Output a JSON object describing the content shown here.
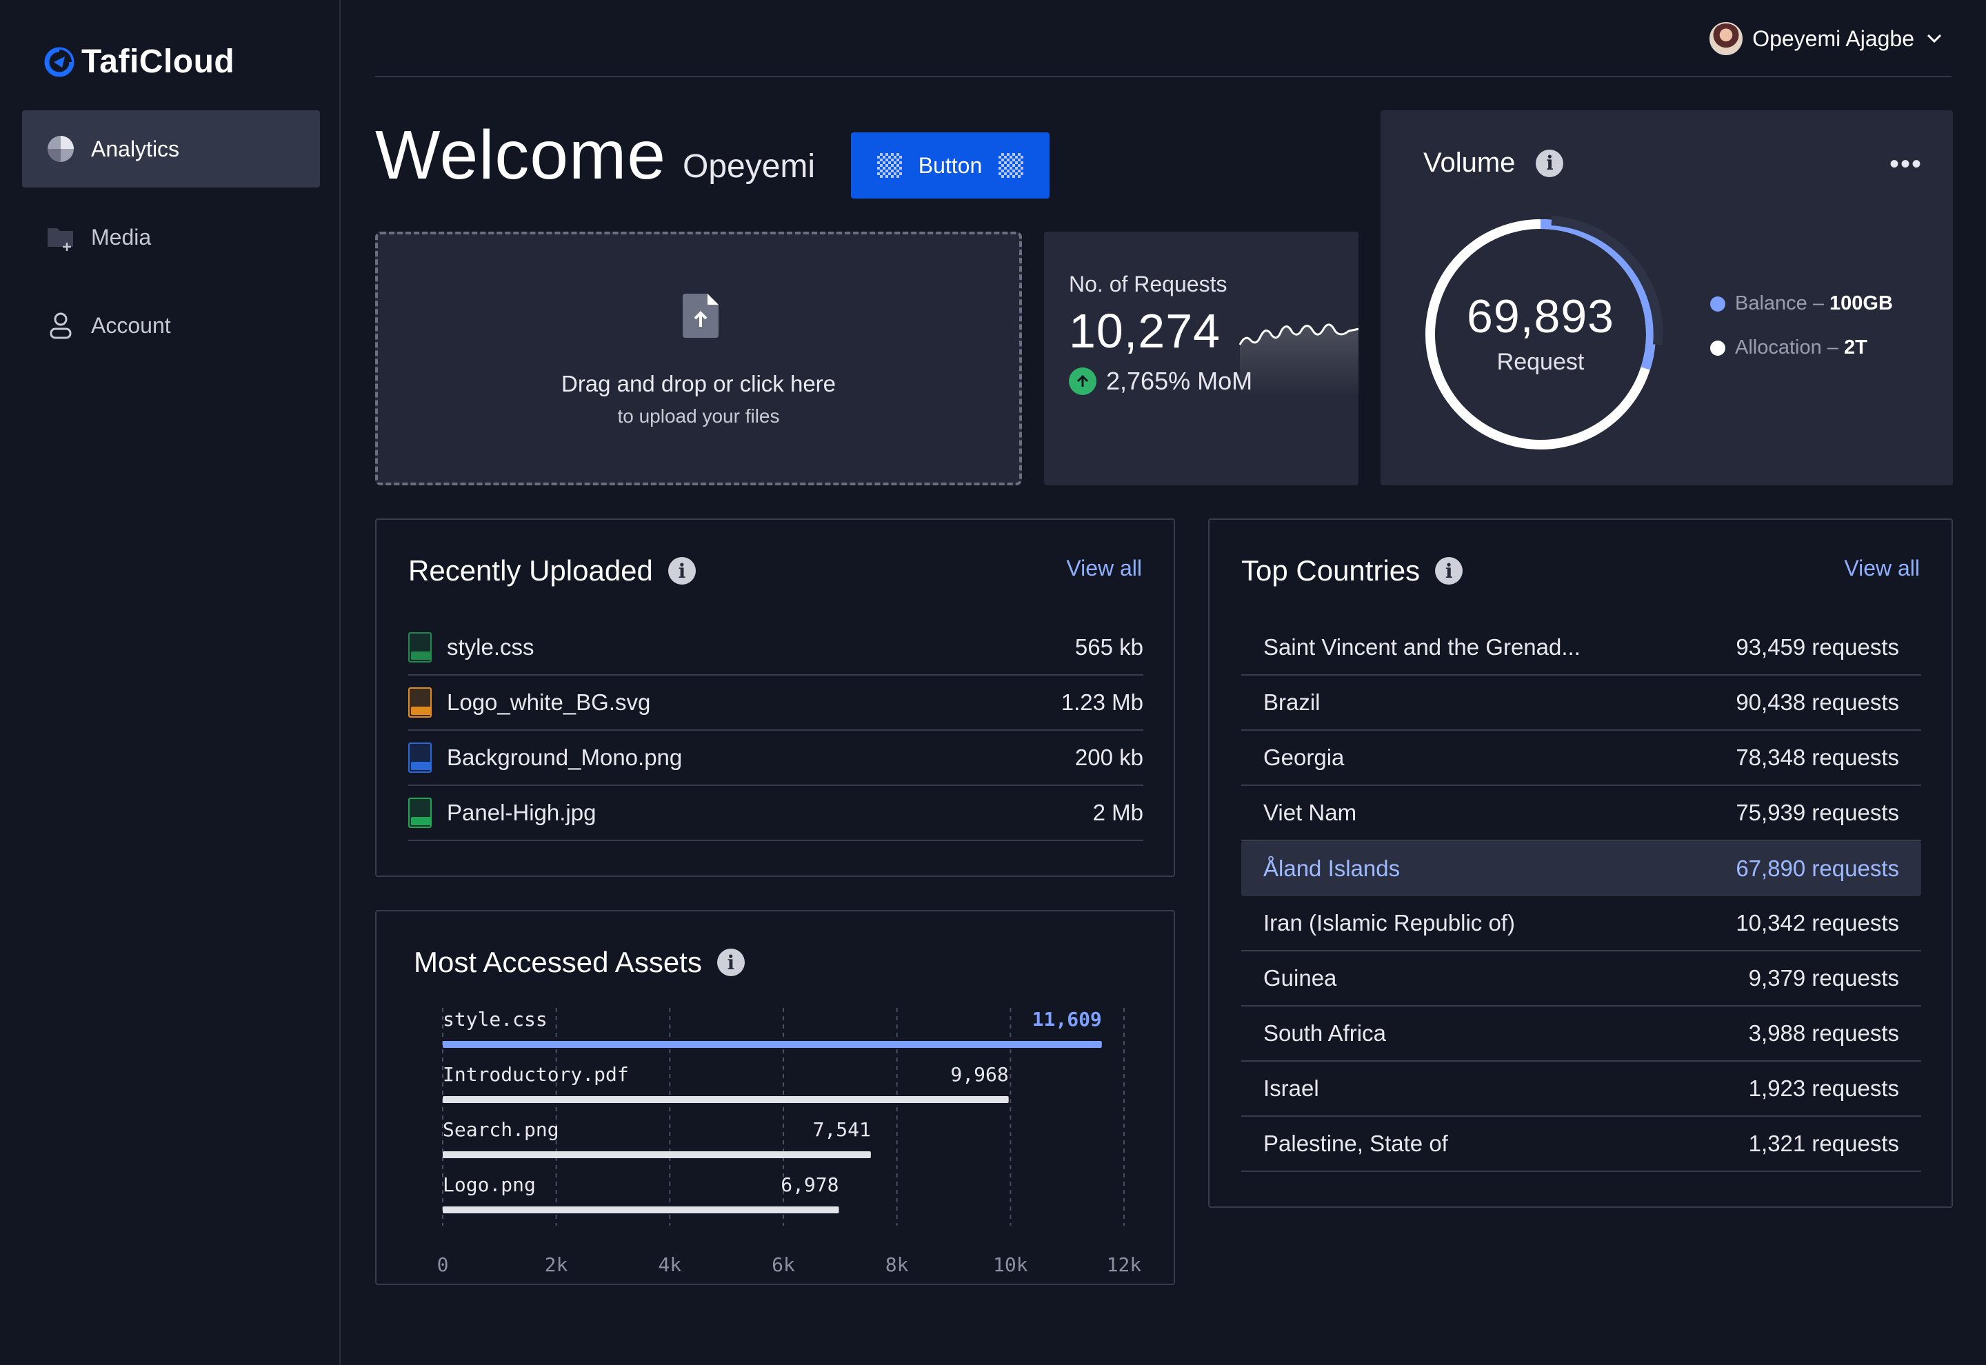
{
  "brand": {
    "name": "TafiCloud"
  },
  "sidebar": {
    "items": [
      {
        "label": "Analytics",
        "icon": "pie-chart-icon",
        "active": true
      },
      {
        "label": "Media",
        "icon": "folder-add-icon",
        "active": false
      },
      {
        "label": "Account",
        "icon": "user-icon",
        "active": false
      }
    ]
  },
  "header": {
    "user_name": "Opeyemi Ajagbe"
  },
  "welcome": {
    "title": "Welcome",
    "name": "Opeyemi",
    "button_label": "Button"
  },
  "upload": {
    "line1": "Drag and drop or click here",
    "line2": "to upload your files"
  },
  "requests": {
    "label": "No. of Requests",
    "value": "10,274",
    "change": "2,765% MoM"
  },
  "volume": {
    "title": "Volume",
    "value": "69,893",
    "unit": "Request",
    "legend": [
      {
        "label": "Balance – ",
        "value": "100GB",
        "color": "#7ea1ff"
      },
      {
        "label": "Allocation – ",
        "value": "2T",
        "color": "#ffffff"
      }
    ],
    "balance_fraction": 0.3
  },
  "recent": {
    "title": "Recently Uploaded",
    "view_all": "View all",
    "files": [
      {
        "name": "style.css",
        "size": "565 kb",
        "type": "css",
        "color": "#1f8a4c"
      },
      {
        "name": "Logo_white_BG.svg",
        "size": "1.23 Mb",
        "type": "svg",
        "color": "#e08a1e"
      },
      {
        "name": "Background_Mono.png",
        "size": "200 kb",
        "type": "png",
        "color": "#2a67d8"
      },
      {
        "name": "Panel-High.jpg",
        "size": "2 Mb",
        "type": "jpg",
        "color": "#20a555"
      }
    ]
  },
  "assets": {
    "title": "Most Accessed Assets"
  },
  "chart_data": {
    "type": "bar",
    "orientation": "horizontal",
    "categories": [
      "style.css",
      "Introductory.pdf",
      "Search.png",
      "Logo.png"
    ],
    "values": [
      11609,
      9968,
      7541,
      6978
    ],
    "value_labels": [
      "11,609",
      "9,968",
      "7,541",
      "6,978"
    ],
    "xlim": [
      0,
      12000
    ],
    "ticks": [
      "0",
      "2k",
      "4k",
      "6k",
      "8k",
      "10k",
      "12k"
    ],
    "tick_values": [
      0,
      2000,
      4000,
      6000,
      8000,
      10000,
      12000
    ],
    "highlight_color": "#7ea1ff",
    "bar_color": "#e3e4ea",
    "grid": true
  },
  "countries": {
    "title": "Top Countries",
    "view_all": "View all",
    "rows": [
      {
        "name": "Saint Vincent and the Grenad...",
        "value": "93,459 requests"
      },
      {
        "name": "Brazil",
        "value": "90,438 requests"
      },
      {
        "name": "Georgia",
        "value": "78,348 requests"
      },
      {
        "name": "Viet Nam",
        "value": "75,939 requests"
      },
      {
        "name": "Åland Islands",
        "value": "67,890 requests",
        "highlighted": true
      },
      {
        "name": "Iran (Islamic Republic of)",
        "value": "10,342 requests"
      },
      {
        "name": "Guinea",
        "value": "9,379 requests"
      },
      {
        "name": "South Africa",
        "value": "3,988 requests"
      },
      {
        "name": "Israel",
        "value": "1,923 requests"
      },
      {
        "name": "Palestine, State of",
        "value": "1,321 requests"
      }
    ]
  }
}
